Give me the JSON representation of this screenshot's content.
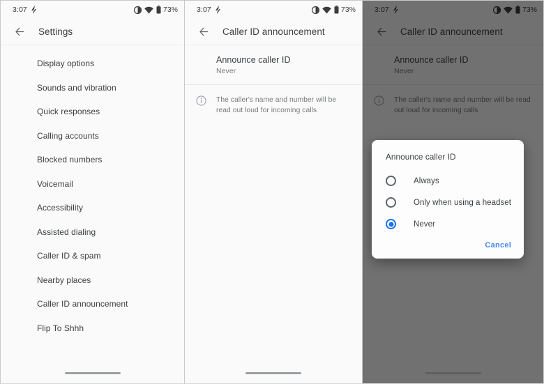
{
  "status_bar": {
    "time": "3:07",
    "flash_icon": "lightning-bolt-icon",
    "alarm_icon": "do-not-disturb-icon",
    "wifi_icon": "wifi-icon",
    "battery_icon": "battery-icon",
    "battery_text": "73%"
  },
  "colors": {
    "accent": "#1a73e8",
    "link": "#4285f4",
    "background": "#fafafa",
    "text_primary": "#3c4043",
    "text_secondary": "#76797c",
    "scrim": "rgba(0,0,0,0.55)"
  },
  "screen1": {
    "title": "Settings",
    "back_icon": "back-arrow-icon",
    "items": [
      {
        "label": "Display options"
      },
      {
        "label": "Sounds and vibration"
      },
      {
        "label": "Quick responses"
      },
      {
        "label": "Calling accounts"
      },
      {
        "label": "Blocked numbers"
      },
      {
        "label": "Voicemail"
      },
      {
        "label": "Accessibility"
      },
      {
        "label": "Assisted dialing"
      },
      {
        "label": "Caller ID & spam"
      },
      {
        "label": "Nearby places"
      },
      {
        "label": "Caller ID announcement"
      },
      {
        "label": "Flip To Shhh"
      }
    ]
  },
  "screen2": {
    "title": "Caller ID announcement",
    "back_icon": "back-arrow-icon",
    "preference": {
      "title": "Announce caller ID",
      "value": "Never"
    },
    "info": {
      "icon": "info-circle-icon",
      "text": "The caller's name and number will be read out loud for incoming calls"
    }
  },
  "screen3": {
    "title": "Caller ID announcement",
    "back_icon": "back-arrow-icon",
    "preference": {
      "title": "Announce caller ID",
      "value": "Never"
    },
    "info": {
      "icon": "info-circle-icon",
      "text": "The caller's name and number will be read out loud for incoming calls"
    },
    "dialog": {
      "title": "Announce caller ID",
      "options": [
        {
          "label": "Always",
          "selected": false
        },
        {
          "label": "Only when using a headset",
          "selected": false
        },
        {
          "label": "Never",
          "selected": true
        }
      ],
      "cancel_label": "Cancel"
    }
  }
}
